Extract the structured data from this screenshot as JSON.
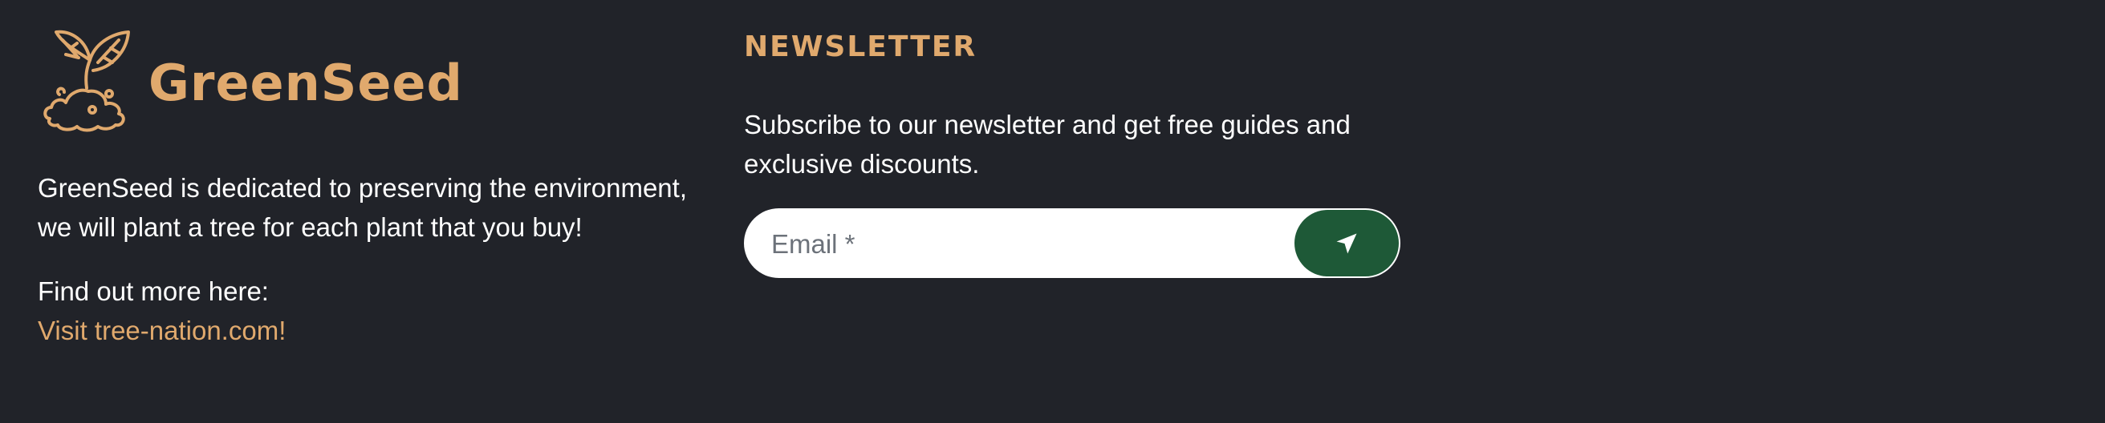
{
  "brand": {
    "name": "GreenSeed",
    "logo_icon": "sprout-in-soil-icon"
  },
  "about": {
    "description": "GreenSeed is dedicated to preserving the environment, we will plant a tree for each plant that you buy!",
    "more_label": "Find out more here:",
    "link_text": "Visit tree-nation.com!"
  },
  "newsletter": {
    "title": "NEWSLETTER",
    "text": "Subscribe to our newsletter and get free guides and exclusive discounts.",
    "email_placeholder": "Email *",
    "submit_icon": "send-icon"
  },
  "colors": {
    "background": "#212329",
    "accent": "#e0a96d",
    "button": "#1e5937"
  }
}
